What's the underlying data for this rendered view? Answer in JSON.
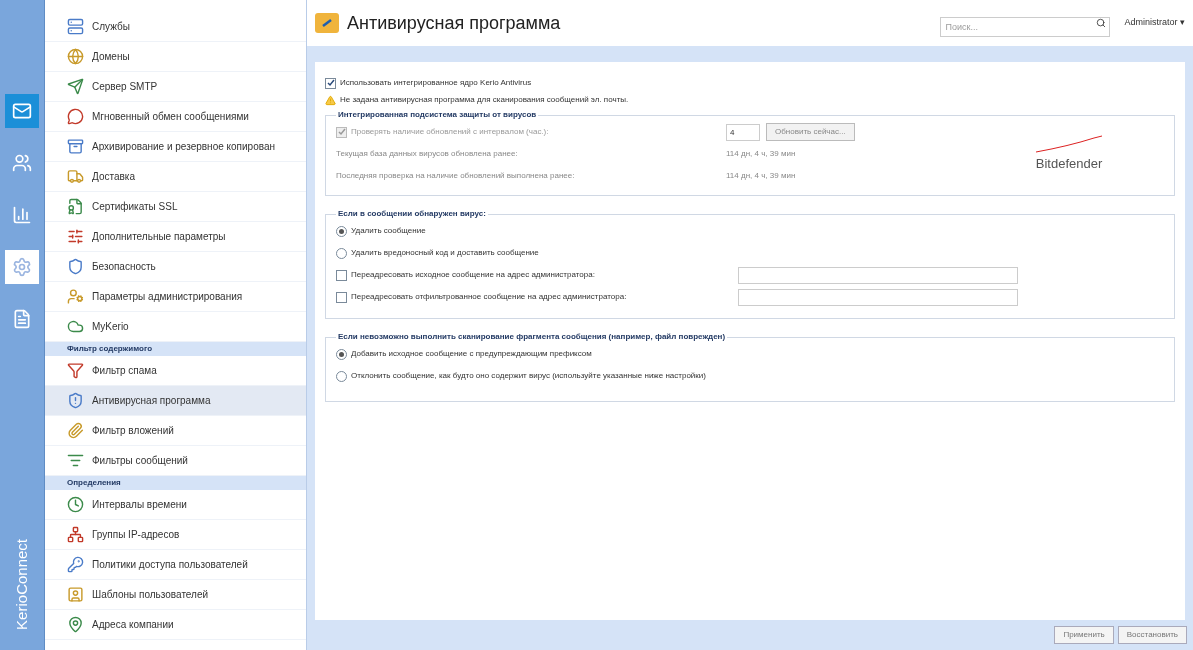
{
  "rail": [
    {
      "kind": "mail",
      "selected": false
    },
    {
      "kind": "users",
      "selected": false
    },
    {
      "kind": "stats",
      "selected": false
    },
    {
      "kind": "settings",
      "selected": true
    },
    {
      "kind": "logs",
      "selected": false
    }
  ],
  "rail_label": "KerioConnect",
  "sidebar": {
    "groups": [
      {
        "items": [
          {
            "label": "Службы",
            "selected": false
          },
          {
            "label": "Домены",
            "selected": false
          },
          {
            "label": "Сервер SMTP",
            "selected": false
          },
          {
            "label": "Мгновенный обмен сообщениями",
            "selected": false
          },
          {
            "label": "Архивирование и резервное копирован",
            "selected": false
          },
          {
            "label": "Доставка",
            "selected": false
          },
          {
            "label": "Сертификаты SSL",
            "selected": false
          },
          {
            "label": "Дополнительные параметры",
            "selected": false
          },
          {
            "label": "Безопасность",
            "selected": false
          },
          {
            "label": "Параметры администрирования",
            "selected": false
          },
          {
            "label": "MyKerio",
            "selected": false
          }
        ]
      },
      {
        "title": "Фильтр содержимого",
        "items": [
          {
            "label": "Фильтр спама",
            "selected": false
          },
          {
            "label": "Антивирусная программа",
            "selected": true
          },
          {
            "label": "Фильтр вложений",
            "selected": false
          },
          {
            "label": "Фильтры сообщений",
            "selected": false
          }
        ]
      },
      {
        "title": "Определения",
        "items": [
          {
            "label": "Интервалы времени",
            "selected": false
          },
          {
            "label": "Группы IP-адресов",
            "selected": false
          },
          {
            "label": "Политики доступа пользователей",
            "selected": false
          },
          {
            "label": "Шаблоны пользователей",
            "selected": false
          },
          {
            "label": "Адреса компании",
            "selected": false
          }
        ]
      }
    ]
  },
  "header": {
    "title": "Антивирусная программа",
    "search": {
      "placeholder": "Поиск..."
    },
    "user": "Administrator ▾"
  },
  "use_engine": {
    "label": "Использовать интегрированное ядро Kerio Antivirus",
    "checked": true
  },
  "warning": "Не задана антивирусная программа для сканирования сообщений эл. почты.",
  "engine_group": {
    "title": "Интегрированная подсистема защиты от вирусов",
    "update_check": {
      "label": "Проверять наличие обновлений с интервалом (час.):",
      "checked": true,
      "disabled": true,
      "value": "4",
      "button": "Обновить сейчас..."
    },
    "info": [
      {
        "label": "Текущая база данных вирусов обновлена ранее:",
        "value": "114 дн, 4 ч, 39 мин"
      },
      {
        "label": "Последняя проверка на наличие обновлений выполнена ранее:",
        "value": "114 дн, 4 ч, 39 мин"
      }
    ],
    "logo": "Bitdefender"
  },
  "virus_group": {
    "title": "Если в сообщении обнаружен вирус:",
    "options": [
      {
        "kind": "radio",
        "label": "Удалить сообщение",
        "selected": true
      },
      {
        "kind": "radio",
        "label": "Удалить вредоносный код и доставить сообщение",
        "selected": false
      },
      {
        "kind": "checkbox",
        "label": "Переадресовать исходное сообщение на адрес администратора:",
        "checked": false
      },
      {
        "kind": "checkbox",
        "label": "Переадресовать отфильтрованное сообщение на адрес администратора:",
        "checked": false
      }
    ]
  },
  "scan_fail_group": {
    "title": "Если невозможно выполнить сканирование фрагмента сообщения (например, файл поврежден)",
    "options": [
      {
        "label": "Добавить исходное сообщение с предупреждающим префиксом",
        "selected": true
      },
      {
        "label": "Отклонить сообщение, как будто оно содержит вирус (используйте указанные ниже настройки)",
        "selected": false
      }
    ]
  },
  "footer": {
    "buttons": [
      "Применить",
      "Восстановить"
    ]
  }
}
